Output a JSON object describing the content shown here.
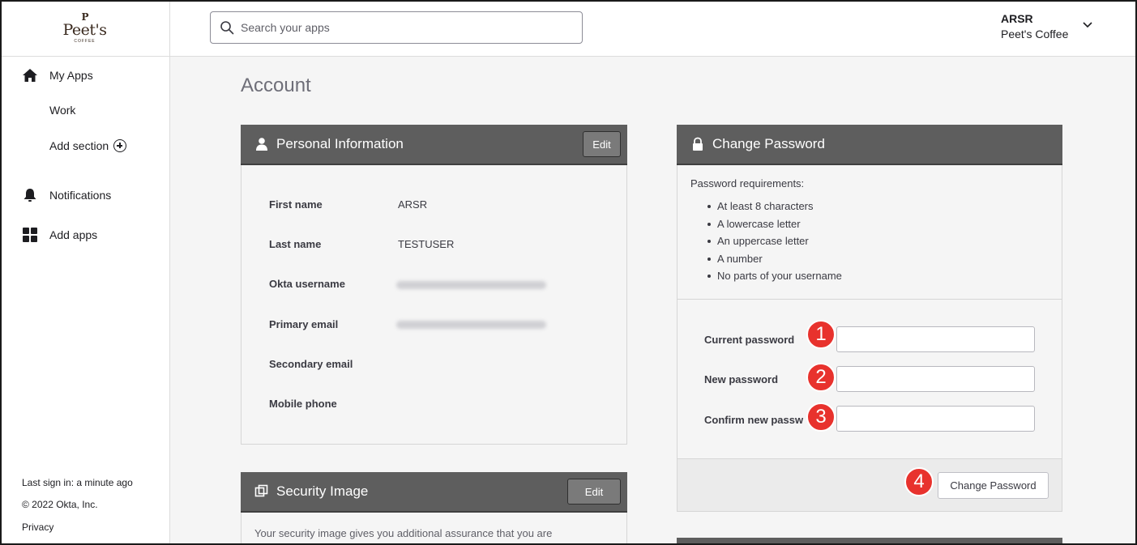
{
  "brand": {
    "logo_mark": "P",
    "logo_word": "Peet's",
    "logo_sub": "COFFEE"
  },
  "sidebar": {
    "items": [
      {
        "label": "My Apps",
        "icon": "home-icon"
      },
      {
        "label": "Work"
      },
      {
        "label": "Add section",
        "icon": "add-circle-icon"
      },
      {
        "label": "Notifications",
        "icon": "bell-icon"
      },
      {
        "label": "Add apps",
        "icon": "grid-icon"
      }
    ],
    "footer": {
      "last_sign_in": "Last sign in: a minute ago",
      "copyright": "© 2022 Okta, Inc.",
      "privacy": "Privacy"
    }
  },
  "header": {
    "search_placeholder": "Search your apps",
    "user_name": "ARSR",
    "user_org": "Peet's Coffee"
  },
  "main": {
    "title": "Account",
    "personal": {
      "title": "Personal Information",
      "edit_label": "Edit",
      "fields": [
        {
          "label": "First name",
          "value": "ARSR"
        },
        {
          "label": "Last name",
          "value": "TESTUSER"
        },
        {
          "label": "Okta username",
          "value": ""
        },
        {
          "label": "Primary email",
          "value": ""
        },
        {
          "label": "Secondary email",
          "value": ""
        },
        {
          "label": "Mobile phone",
          "value": ""
        }
      ]
    },
    "security_image": {
      "title": "Security Image",
      "edit_label": "Edit",
      "description": "Your security image gives you additional assurance that you are"
    },
    "change_password": {
      "title": "Change Password",
      "requirements_title": "Password requirements:",
      "requirements": [
        "At least 8 characters",
        "A lowercase letter",
        "An uppercase letter",
        "A number",
        "No parts of your username"
      ],
      "current_label": "Current password",
      "new_label": "New password",
      "confirm_label": "Confirm new passw",
      "button_label": "Change Password"
    },
    "badges": [
      "1",
      "2",
      "3",
      "4"
    ]
  },
  "colors": {
    "panel_header": "#5e5e5e",
    "badge": "#e8322d",
    "page_bg": "#f5f5f5"
  }
}
